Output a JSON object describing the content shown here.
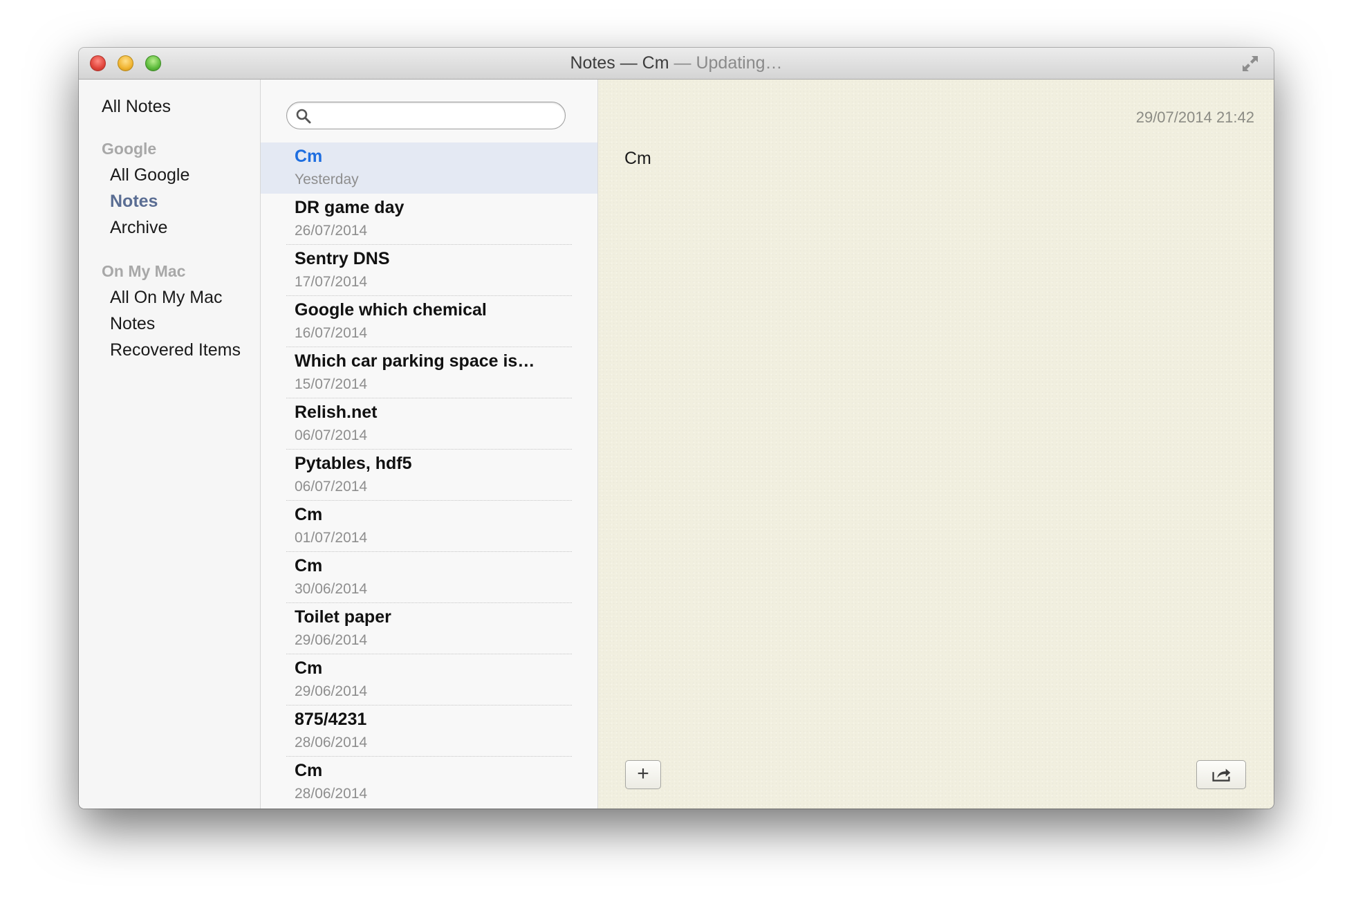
{
  "window": {
    "title": "Notes — Cm",
    "status": " — Updating…"
  },
  "sidebar": {
    "all_notes": "All Notes",
    "groups": [
      {
        "header": "Google",
        "items": [
          {
            "label": "All Google",
            "selected": false
          },
          {
            "label": "Notes",
            "selected": true
          },
          {
            "label": "Archive",
            "selected": false
          }
        ]
      },
      {
        "header": "On My Mac",
        "items": [
          {
            "label": "All On My Mac",
            "selected": false
          },
          {
            "label": "Notes",
            "selected": false
          },
          {
            "label": "Recovered Items",
            "selected": false
          }
        ]
      }
    ]
  },
  "search": {
    "value": "",
    "placeholder": ""
  },
  "notes": [
    {
      "title": "Cm",
      "date": "Yesterday",
      "selected": true
    },
    {
      "title": "DR game day",
      "date": "26/07/2014"
    },
    {
      "title": "Sentry DNS",
      "date": "17/07/2014"
    },
    {
      "title": "Google which chemical",
      "date": "16/07/2014"
    },
    {
      "title": "Which car parking space is…",
      "date": "15/07/2014"
    },
    {
      "title": "Relish.net",
      "date": "06/07/2014"
    },
    {
      "title": "Pytables, hdf5",
      "date": "06/07/2014"
    },
    {
      "title": "Cm",
      "date": "01/07/2014"
    },
    {
      "title": "Cm",
      "date": "30/06/2014"
    },
    {
      "title": "Toilet paper",
      "date": "29/06/2014"
    },
    {
      "title": "Cm",
      "date": "29/06/2014"
    },
    {
      "title": "875/4231",
      "date": "28/06/2014"
    },
    {
      "title": "Cm",
      "date": "28/06/2014"
    }
  ],
  "editor": {
    "timestamp": "29/07/2014 21:42",
    "body": "Cm",
    "add_label": "+"
  },
  "colors": {
    "accent": "#1e6ee0",
    "sidebar_selected": "#5a6d93",
    "paper": "#f1efdf",
    "selected_row": "#e4e9f3"
  },
  "icons": {
    "search": "search-icon",
    "fullscreen": "fullscreen-icon",
    "share": "share-icon"
  }
}
